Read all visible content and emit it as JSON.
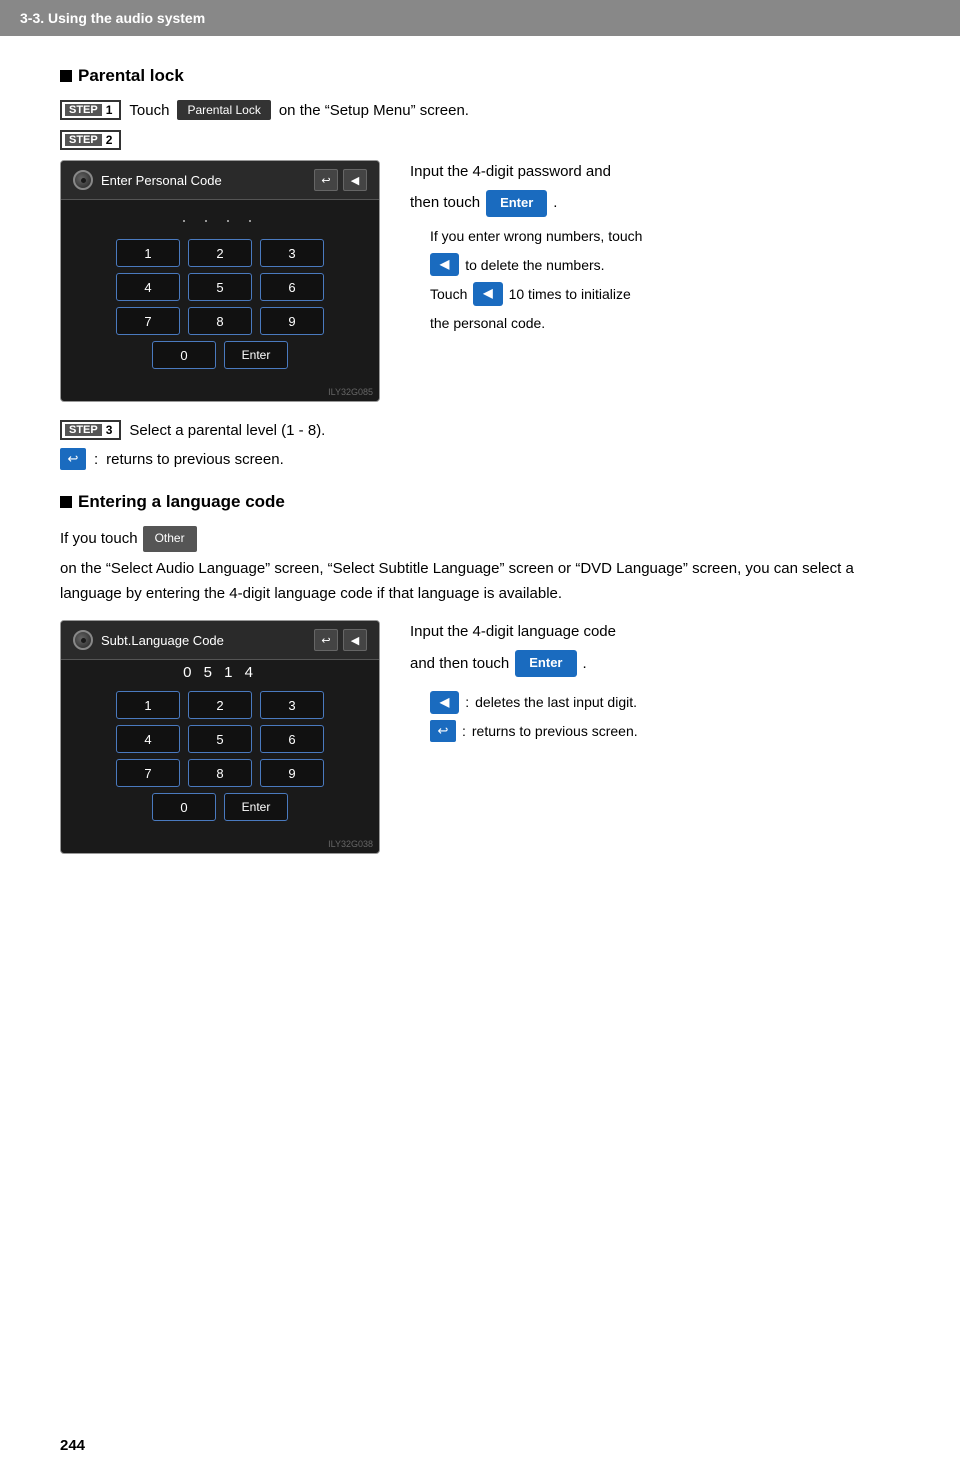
{
  "header": {
    "title": "3-3. Using the audio system"
  },
  "page_number": "244",
  "parental_lock": {
    "section_title": "Parental lock",
    "step1": {
      "badge_label": "STEP",
      "badge_num": "1",
      "text_before": "Touch",
      "button_label": "Parental Lock",
      "text_after": "on the “Setup Menu” screen."
    },
    "step2": {
      "badge_label": "STEP",
      "badge_num": "2"
    },
    "screen1": {
      "header_title": "Enter Personal Code",
      "dots": ". . . .",
      "numpad": [
        [
          "1",
          "2",
          "3"
        ],
        [
          "4",
          "5",
          "6"
        ],
        [
          "7",
          "8",
          "9"
        ],
        [
          "0",
          "Enter"
        ]
      ],
      "watermark": "ILY32G085"
    },
    "desc": {
      "line1": "Input  the  4-digit  password  and",
      "line2": "then touch",
      "enter_btn": "Enter",
      "line3": ".",
      "note1_prefix": "If you enter wrong numbers, touch",
      "note1_suffix": "to delete the numbers.",
      "note2_prefix": "Touch",
      "note2_middle": "10 times to initialize",
      "note2_suffix": "the personal code."
    },
    "step3": {
      "badge_label": "STEP",
      "badge_num": "3",
      "text": "Select a parental level (1 - 8)."
    },
    "back_note": {
      "colon": ":",
      "text": "  returns to previous screen."
    }
  },
  "language_code": {
    "section_title": "Entering a language code",
    "body": "If you touch",
    "other_btn": "Other",
    "body2": " on the “Select Audio Language” screen, “Select Subtitle Language” screen or “DVD Language” screen, you can select a language by entering the 4-digit language code if that language is available.",
    "screen2": {
      "header_title": "Subt.Language Code",
      "code_display": "0 5 1 4",
      "numpad": [
        [
          "1",
          "2",
          "3"
        ],
        [
          "4",
          "5",
          "6"
        ],
        [
          "7",
          "8",
          "9"
        ],
        [
          "0",
          "Enter"
        ]
      ],
      "watermark": "ILY32G038"
    },
    "desc": {
      "line1": "Input  the  4-digit  language  code",
      "line2": "and then touch",
      "enter_btn": "Enter",
      "line3": ".",
      "note1_colon": ":",
      "note1_text": "  deletes the last input digit.",
      "note2_colon": ":",
      "note2_text": "  returns      to      previous screen."
    }
  }
}
